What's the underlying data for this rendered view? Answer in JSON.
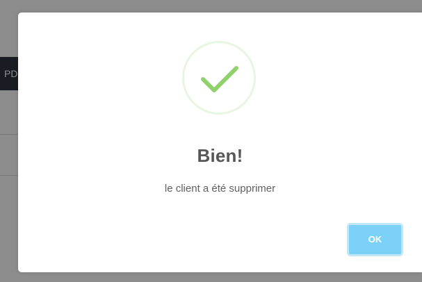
{
  "background": {
    "partial_button_text": "PD"
  },
  "dialog": {
    "icon": "check-icon",
    "title": "Bien!",
    "message": "le client a été supprimer",
    "ok_label": "OK"
  },
  "colors": {
    "success_check": "#8fd16a",
    "success_ring": "#e9f5e0",
    "ok_button": "#7cd1f9",
    "ok_button_border": "#c1e6f7",
    "title_text": "#575757",
    "overlay": "rgba(0,0,0,0.45)"
  }
}
